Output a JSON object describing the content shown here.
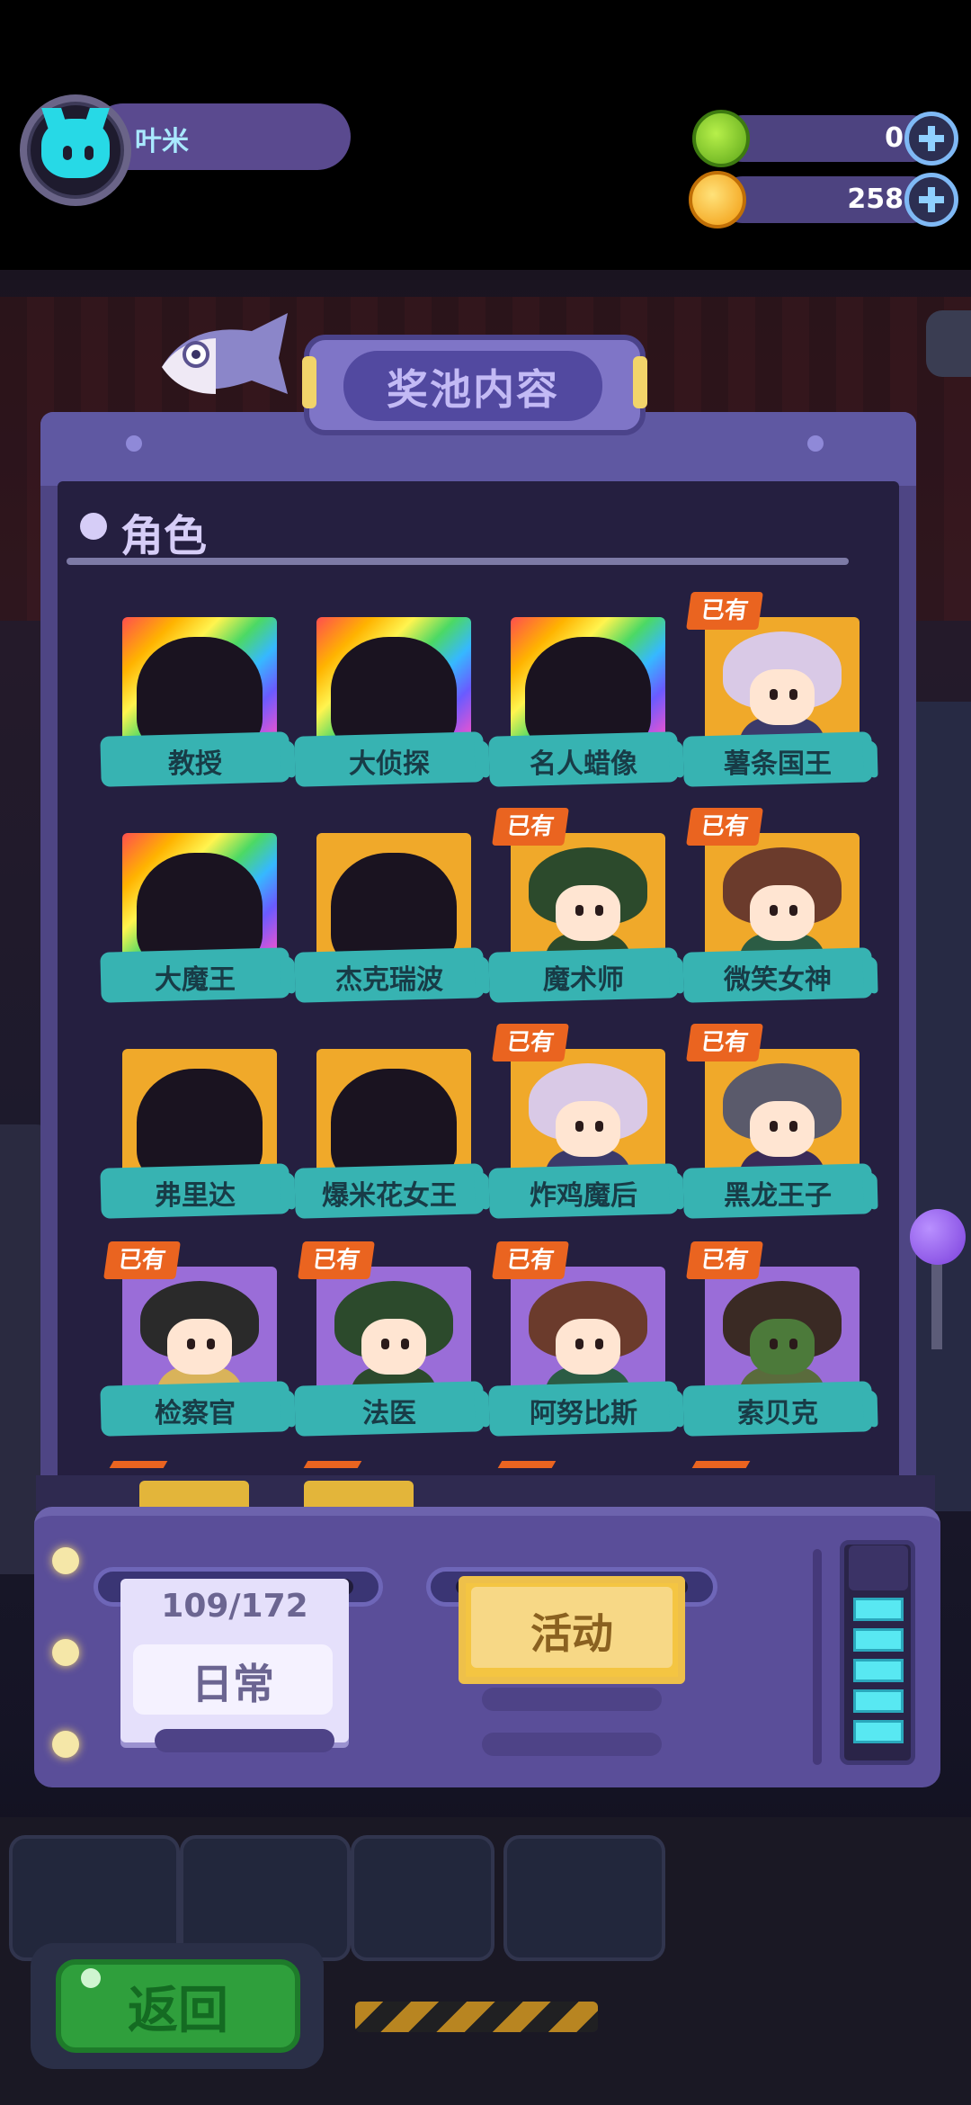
{
  "player": {
    "name": "叶米"
  },
  "currency": [
    {
      "icon": "green-gem-icon",
      "value": "0"
    },
    {
      "icon": "gold-planet-coin-icon",
      "value": "258"
    }
  ],
  "panel": {
    "title": "奖池内容",
    "section_title": "角色"
  },
  "owned_label": "已有",
  "characters": [
    {
      "name": "教授",
      "owned": false,
      "frame": "rainbow"
    },
    {
      "name": "大侦探",
      "owned": false,
      "frame": "rainbow"
    },
    {
      "name": "名人蜡像",
      "owned": false,
      "frame": "rainbow"
    },
    {
      "name": "薯条国王",
      "owned": true,
      "frame": "gold"
    },
    {
      "name": "大魔王",
      "owned": false,
      "frame": "rainbow"
    },
    {
      "name": "杰克瑞波",
      "owned": false,
      "frame": "gold"
    },
    {
      "name": "魔术师",
      "owned": true,
      "frame": "gold"
    },
    {
      "name": "微笑女神",
      "owned": true,
      "frame": "gold"
    },
    {
      "name": "弗里达",
      "owned": false,
      "frame": "gold"
    },
    {
      "name": "爆米花女王",
      "owned": false,
      "frame": "gold"
    },
    {
      "name": "炸鸡魔后",
      "owned": true,
      "frame": "gold"
    },
    {
      "name": "黑龙王子",
      "owned": true,
      "frame": "gold"
    },
    {
      "name": "检察官",
      "owned": true,
      "frame": "purple"
    },
    {
      "name": "法医",
      "owned": true,
      "frame": "purple"
    },
    {
      "name": "阿努比斯",
      "owned": true,
      "frame": "purple"
    },
    {
      "name": "索贝克",
      "owned": true,
      "frame": "purple"
    }
  ],
  "pool_tabs": {
    "daily": {
      "label": "日常",
      "count": "109/172"
    },
    "event": {
      "label": "活动"
    }
  },
  "back_button": {
    "label": "返回"
  }
}
